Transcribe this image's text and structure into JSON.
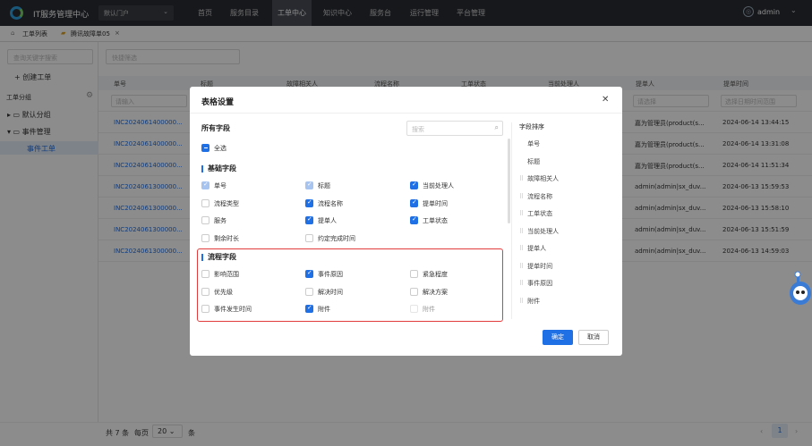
{
  "app": {
    "title": "IT服务管理中心",
    "portal": "默认门户",
    "user": "admin"
  },
  "nav": [
    "首页",
    "服务目录",
    "工单中心",
    "知识中心",
    "服务台",
    "运行管理",
    "平台管理"
  ],
  "tabs": [
    "工单列表",
    "腾讯故障单05"
  ],
  "sidebar": {
    "search_placeholder": "查询关键字搜索",
    "create": "+ 创建工单",
    "group_title": "工单分组",
    "items": [
      "默认分组",
      "事件管理",
      "事件工单"
    ]
  },
  "main": {
    "filter_placeholder": "快捷筛选",
    "columns": [
      "单号",
      "标题",
      "故障相关人",
      "流程名称",
      "工单状态",
      "当前处理人",
      "提单人",
      "提单时间"
    ],
    "filter_inputs": {
      "id": "请输入",
      "submitter": "请选择",
      "time": "选择日期时间范围"
    },
    "rows": [
      {
        "id": "INC2024061400000...",
        "submitter": "嘉为管理员(product(s...",
        "time": "2024-06-14 13:44:15"
      },
      {
        "id": "INC2024061400000...",
        "submitter": "嘉为管理员(product(s...",
        "time": "2024-06-14 13:31:08"
      },
      {
        "id": "INC2024061400000...",
        "submitter": "嘉为管理员(product(s...",
        "time": "2024-06-14 11:51:34"
      },
      {
        "id": "INC2024061300000...",
        "submitter": "admin(admin|sx_duv...",
        "time": "2024-06-13 15:59:53"
      },
      {
        "id": "INC2024061300000...",
        "submitter": "admin(admin|sx_duv...",
        "time": "2024-06-13 15:58:10"
      },
      {
        "id": "INC2024061300000...",
        "submitter": "admin(admin|sx_duv...",
        "time": "2024-06-13 15:51:59"
      },
      {
        "id": "INC2024061300000...",
        "submitter": "admin(admin|sx_duv...",
        "time": "2024-06-13 14:59:03"
      }
    ]
  },
  "footer": {
    "total": "共 7 条",
    "per_page": "每页",
    "page_size": "20",
    "unit": "条",
    "page": "1"
  },
  "modal": {
    "title": "表格设置",
    "all_fields": "所有字段",
    "search_placeholder": "搜索",
    "select_all": "全选",
    "basic_section": "基础字段",
    "basic_fields": [
      {
        "label": "单号",
        "state": "disabled"
      },
      {
        "label": "标题",
        "state": "disabled"
      },
      {
        "label": "当前处理人",
        "state": "checked"
      },
      {
        "label": "流程类型",
        "state": "unchecked"
      },
      {
        "label": "流程名称",
        "state": "checked"
      },
      {
        "label": "提单时间",
        "state": "checked"
      },
      {
        "label": "服务",
        "state": "unchecked"
      },
      {
        "label": "提单人",
        "state": "checked"
      },
      {
        "label": "工单状态",
        "state": "checked"
      },
      {
        "label": "剩余时长",
        "state": "unchecked"
      },
      {
        "label": "约定完成时间",
        "state": "unchecked"
      }
    ],
    "flow_section": "流程字段",
    "flow_fields": [
      {
        "label": "影响范围",
        "state": "unchecked"
      },
      {
        "label": "事件原因",
        "state": "checked"
      },
      {
        "label": "紧急程度",
        "state": "unchecked"
      },
      {
        "label": "优先级",
        "state": "unchecked"
      },
      {
        "label": "解决时间",
        "state": "unchecked"
      },
      {
        "label": "解决方案",
        "state": "unchecked"
      },
      {
        "label": "事件发生时间",
        "state": "unchecked"
      },
      {
        "label": "附件",
        "state": "checked"
      },
      {
        "label": "附件",
        "state": "faded"
      }
    ],
    "sort_title": "字段排序",
    "sort_fields": [
      "单号",
      "标题",
      "故障相关人",
      "流程名称",
      "工单状态",
      "当前处理人",
      "提单人",
      "提单时间",
      "事件原因",
      "附件"
    ],
    "ok": "确定",
    "cancel": "取消"
  },
  "colors": {
    "accent": "#1f6fe5",
    "highlight": "#e23b3b",
    "topbar": "#2a2d33"
  }
}
